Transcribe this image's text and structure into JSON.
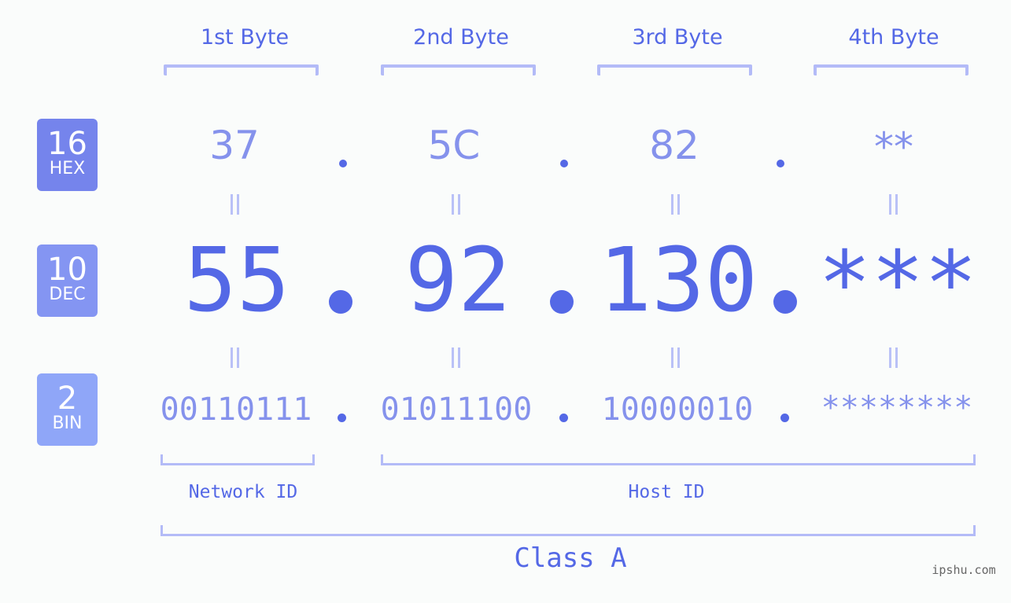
{
  "headers": [
    "1st Byte",
    "2nd Byte",
    "3rd Byte",
    "4th Byte"
  ],
  "badges": {
    "hex": {
      "number": "16",
      "label": "HEX",
      "color": "#7584ec"
    },
    "dec": {
      "number": "10",
      "label": "DEC",
      "color": "#8495f2"
    },
    "bin": {
      "number": "2",
      "label": "BIN",
      "color": "#8fa6f8"
    }
  },
  "hex": [
    "37",
    "5C",
    "82",
    "**"
  ],
  "dec": [
    "55",
    "92",
    "130",
    "***"
  ],
  "bin": [
    "00110111",
    "01011100",
    "10000010",
    "********"
  ],
  "separator": ".",
  "network_id_label": "Network ID",
  "host_id_label": "Host ID",
  "class_label": "Class A",
  "watermark": "ipshu.com",
  "colors": {
    "accent": "#5468e6",
    "light_value": "#8592ec",
    "bracket": "#b3bbf7",
    "background": "#fafcfb"
  }
}
